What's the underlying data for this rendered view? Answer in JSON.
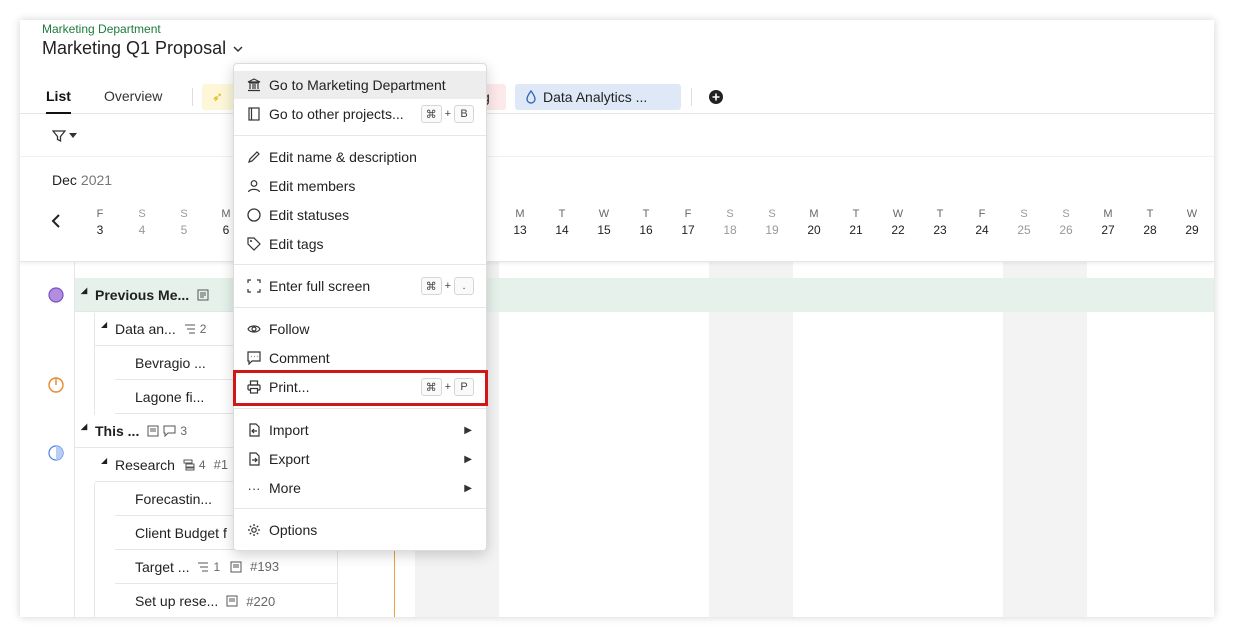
{
  "header": {
    "department": "Marketing Department",
    "project_title": "Marketing Q1 Proposal"
  },
  "tabs": [
    {
      "label": "List"
    },
    {
      "label": "Overview"
    }
  ],
  "chips": {
    "partial_right": "g",
    "data_analytics": "Data Analytics ..."
  },
  "timeline": {
    "month": "Dec",
    "year": "2021",
    "days": [
      {
        "l": "F",
        "n": "3"
      },
      {
        "l": "S",
        "n": "4"
      },
      {
        "l": "S",
        "n": "5"
      },
      {
        "l": "M",
        "n": "6"
      },
      {
        "l": "M",
        "n": "13"
      },
      {
        "l": "T",
        "n": "14"
      },
      {
        "l": "W",
        "n": "15"
      },
      {
        "l": "T",
        "n": "16"
      },
      {
        "l": "F",
        "n": "17"
      },
      {
        "l": "S",
        "n": "18"
      },
      {
        "l": "S",
        "n": "19"
      },
      {
        "l": "M",
        "n": "20"
      },
      {
        "l": "T",
        "n": "21"
      },
      {
        "l": "W",
        "n": "22"
      },
      {
        "l": "T",
        "n": "23"
      },
      {
        "l": "F",
        "n": "24"
      },
      {
        "l": "S",
        "n": "25"
      },
      {
        "l": "S",
        "n": "26"
      },
      {
        "l": "M",
        "n": "27"
      },
      {
        "l": "T",
        "n": "28"
      },
      {
        "l": "W",
        "n": "29"
      }
    ]
  },
  "rows": [
    {
      "label": "Previous Me...",
      "meta": ""
    },
    {
      "label": "Data an...",
      "meta": "2"
    },
    {
      "label": "Bevragio ...",
      "meta": ""
    },
    {
      "label": "Lagone fi...",
      "meta": ""
    },
    {
      "label": "This ...",
      "meta": "3"
    },
    {
      "label": "Research",
      "meta": "4",
      "extra": "#1"
    },
    {
      "label": "Forecastin...",
      "meta": ""
    },
    {
      "label": "Client Budget f",
      "meta": ""
    },
    {
      "label": "Target ...",
      "meta": "1",
      "extra": "#193"
    },
    {
      "label": "Set up rese...",
      "meta": "",
      "extra": "#220"
    }
  ],
  "menu": {
    "items": [
      {
        "label": "Go to Marketing Department",
        "icon": "bank-icon"
      },
      {
        "label": "Go to other projects...",
        "icon": "notebook-icon",
        "keys": [
          "⌘",
          "+",
          "B"
        ]
      },
      {
        "label": "Edit name & description",
        "icon": "pencil-icon"
      },
      {
        "label": "Edit members",
        "icon": "person-icon"
      },
      {
        "label": "Edit statuses",
        "icon": "circle-icon"
      },
      {
        "label": "Edit tags",
        "icon": "tag-icon"
      },
      {
        "label": "Enter full screen",
        "icon": "fullscreen-icon",
        "keys": [
          "⌘",
          "+",
          "."
        ]
      },
      {
        "label": "Follow",
        "icon": "eye-icon"
      },
      {
        "label": "Comment",
        "icon": "comment-icon"
      },
      {
        "label": "Print...",
        "icon": "printer-icon",
        "keys": [
          "⌘",
          "+",
          "P"
        ]
      },
      {
        "label": "Import",
        "icon": "import-icon"
      },
      {
        "label": "Export",
        "icon": "export-icon"
      },
      {
        "label": "More",
        "icon": "ellipsis-icon"
      },
      {
        "label": "Options",
        "icon": "gear-icon"
      }
    ]
  },
  "colors": {
    "department_text": "#1d7a3a",
    "group_band": "#e5f1ea",
    "highlight_border": "#d01818",
    "data_analytics_chip": "#dfe8f7"
  }
}
